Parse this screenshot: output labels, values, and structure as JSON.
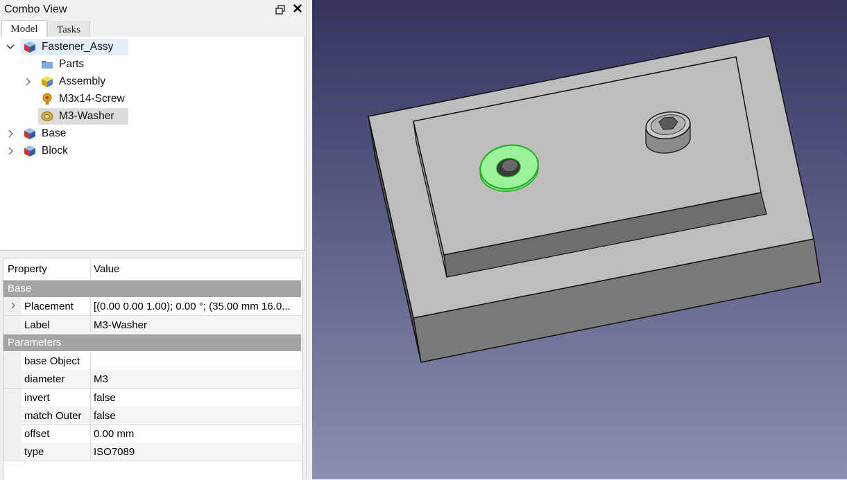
{
  "panel": {
    "title": "Combo View",
    "float_icon": "float-window-icon",
    "close_glyph": "✕"
  },
  "tabs": [
    {
      "label": "Model",
      "active": true
    },
    {
      "label": "Tasks",
      "active": false
    }
  ],
  "tree": {
    "root": {
      "label": "Fastener_Assy",
      "expanded": true,
      "icon": "part-icon"
    },
    "children": [
      {
        "label": "Parts",
        "icon": "folder-icon",
        "expandable": false
      },
      {
        "label": "Assembly",
        "icon": "assembly-icon",
        "expandable": true
      },
      {
        "label": "M3x14-Screw",
        "icon": "screw-icon",
        "expandable": false
      },
      {
        "label": "M3-Washer",
        "icon": "washer-icon",
        "expandable": false,
        "selected": true
      }
    ],
    "siblings": [
      {
        "label": "Base",
        "icon": "part-icon",
        "expandable": true
      },
      {
        "label": "Block",
        "icon": "part-icon",
        "expandable": true
      }
    ]
  },
  "properties": {
    "header": {
      "property": "Property",
      "value": "Value"
    },
    "groups": [
      {
        "name": "Base",
        "rows": [
          {
            "name": "Placement",
            "value": "[(0.00 0.00 1.00); 0.00 °; (35.00 mm  16.0...",
            "expandable": true
          },
          {
            "name": "Label",
            "value": "M3-Washer"
          }
        ]
      },
      {
        "name": "Parameters",
        "rows": [
          {
            "name": "base Object",
            "value": ""
          },
          {
            "name": "diameter",
            "value": "M3"
          },
          {
            "name": "invert",
            "value": "false"
          },
          {
            "name": "match Outer",
            "value": "false"
          },
          {
            "name": "offset",
            "value": "0.00 mm"
          },
          {
            "name": "type",
            "value": "ISO7089"
          }
        ]
      }
    ]
  },
  "viewport": {
    "background_top": "#34345f",
    "background_bottom": "#8c8fb0",
    "selection_color": "#8ef08e",
    "selection_outline": "#22c022",
    "model_face": "#bdbdbd",
    "model_side": "#727272",
    "model_front": "#7a7a7a"
  }
}
